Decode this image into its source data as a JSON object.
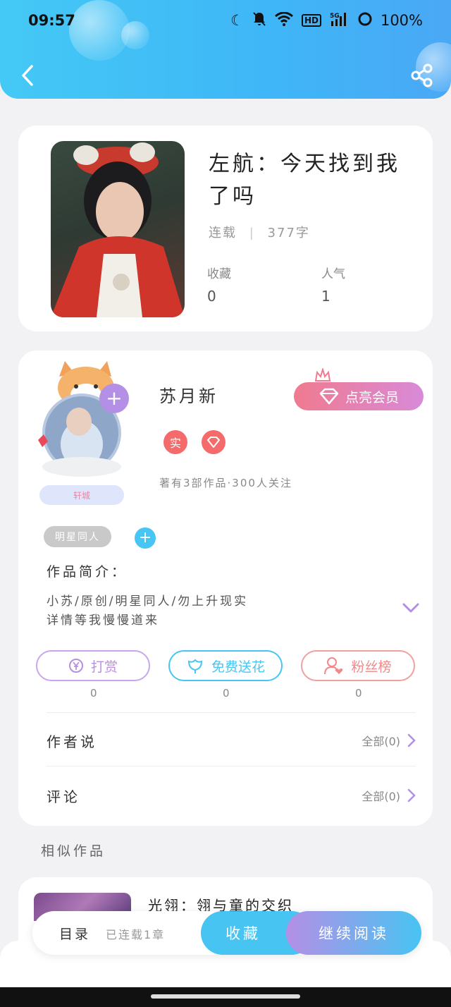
{
  "status_bar": {
    "time": "09:57",
    "battery": "100%"
  },
  "book": {
    "title": "左航：今天找到我了吗",
    "status": "连载",
    "word_count": "377字",
    "favorites_label": "收藏",
    "favorites_value": "0",
    "popularity_label": "人气",
    "popularity_value": "1"
  },
  "author": {
    "name": "苏月新",
    "vip_button": "点亮会员",
    "badge_real": "实",
    "avatar_label": "轩城",
    "stats": "著有3部作品·300人关注",
    "tag": "明星同人",
    "intro_label": "作品简介：",
    "intro_line1": "小苏/原创/明星同人/勿上升现实",
    "intro_line2": "详情等我慢慢道来"
  },
  "actions": [
    {
      "label": "打赏",
      "count": "0",
      "color": "#b98ee0"
    },
    {
      "label": "免费送花",
      "count": "0",
      "color": "#47c6f3"
    },
    {
      "label": "粉丝榜",
      "count": "0",
      "color": "#f08a8a"
    }
  ],
  "author_says": {
    "title": "作者说",
    "right": "全部(0)"
  },
  "comments": {
    "title": "评论",
    "right": "全部(0)"
  },
  "similar": {
    "label": "相似作品",
    "first_title": "光翎：翎与童的交织"
  },
  "bottom_bar": {
    "toc": "目录",
    "toc_status": "已连载1章",
    "favorite": "收藏",
    "continue": "继续阅读"
  }
}
